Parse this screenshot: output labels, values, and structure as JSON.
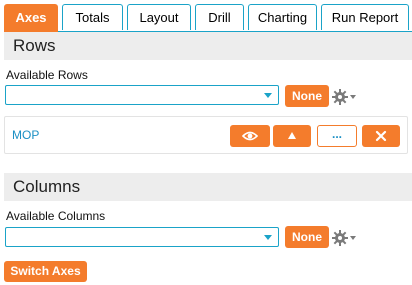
{
  "tabs": [
    {
      "label": "Axes",
      "active": true
    },
    {
      "label": "Totals",
      "active": false
    },
    {
      "label": "Layout",
      "active": false
    },
    {
      "label": "Drill",
      "active": false
    },
    {
      "label": "Charting",
      "active": false
    },
    {
      "label": "Run Report",
      "active": false
    }
  ],
  "rows_section": {
    "title": "Rows",
    "field_label": "Available Rows",
    "select_value": "",
    "none_label": "None",
    "items": [
      {
        "label": "MOP",
        "more_label": "..."
      }
    ]
  },
  "columns_section": {
    "title": "Columns",
    "field_label": "Available Columns",
    "select_value": "",
    "none_label": "None"
  },
  "switch_axes_label": "Switch Axes",
  "colors": {
    "accent": "#f47c2c",
    "border_blue": "#1aa3c8",
    "link_blue": "#1a8fc4",
    "header_bg": "#ededed"
  }
}
